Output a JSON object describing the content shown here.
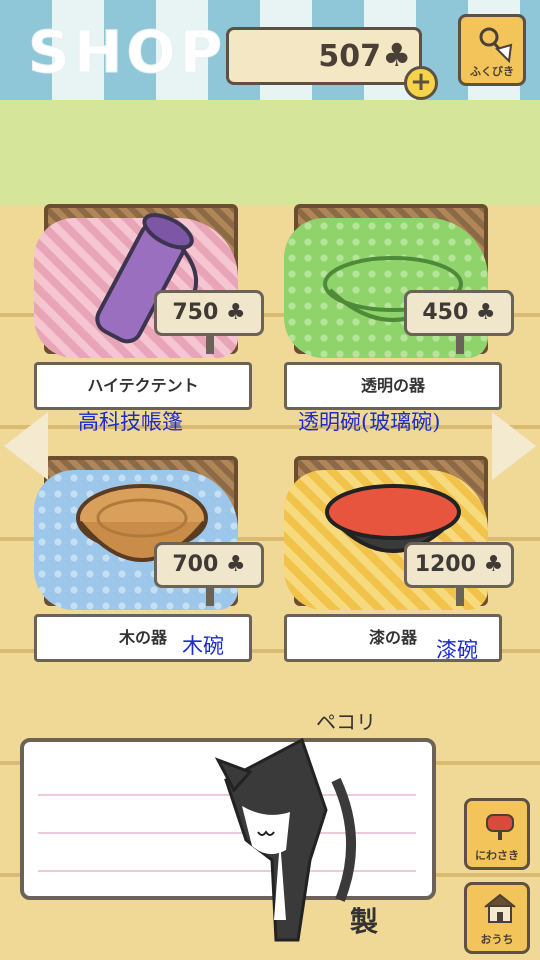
{
  "header": {
    "title": "SHOP",
    "coins": "507",
    "coin_symbol": "♣",
    "plus": "+",
    "fukubiki_label": "ふくびき"
  },
  "items": [
    {
      "name": "ハイテクテント",
      "sub": "高科技帳篷",
      "price": "750 ♣",
      "cloth_color": "#e8a5b8"
    },
    {
      "name": "透明の器",
      "sub": "透明碗(玻璃碗)",
      "price": "450 ♣",
      "cloth_color": "#8fd36b"
    },
    {
      "name": "木の器",
      "sub": "木碗",
      "price": "700 ♣",
      "cloth_color": "#9cc7ea"
    },
    {
      "name": "漆の器",
      "sub": "漆碗",
      "price": "1200 ♣",
      "cloth_color": "#f2c34a"
    }
  ],
  "message": {
    "pekori": "ペコリ",
    "sei": "製"
  },
  "side_buttons": {
    "niwasaki_label": "にわさき",
    "ouchi_label": "おうち"
  }
}
